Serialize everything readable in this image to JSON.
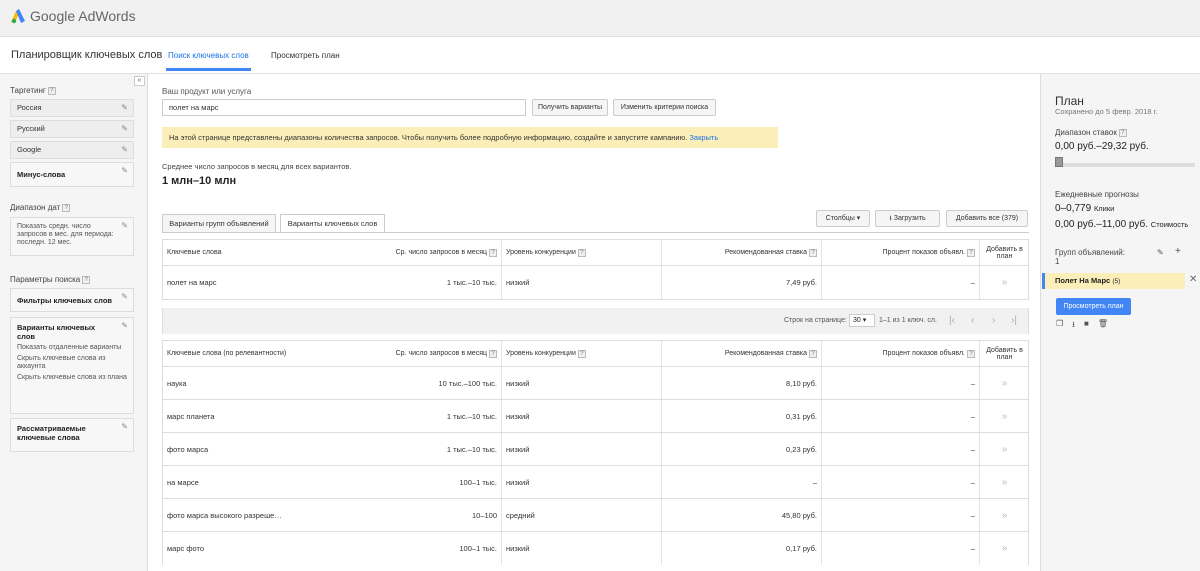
{
  "app": {
    "logo_text": "Google AdWords"
  },
  "header": {
    "page_title": "Планировщик ключевых слов",
    "tabs": [
      {
        "label": "Поиск ключевых слов",
        "active": true
      },
      {
        "label": "Просмотреть план",
        "active": false
      }
    ]
  },
  "left": {
    "collapse_label": "«",
    "targeting_label": "Таргетинг",
    "targeting_items": [
      "Россия",
      "Русский",
      "Google",
      "Минус-слова"
    ],
    "date_label": "Диапазон дат",
    "date_text": "Показать средн. число запросов в мес. для периода: последн. 12 мес.",
    "search_params_label": "Параметры поиска",
    "filters_label": "Фильтры ключевых слов",
    "variants_title": "Варианты ключевых слов",
    "variants_options": [
      "Показать отдаленные варианты",
      "Скрыть ключевые слова из аккаунта",
      "Скрыть ключевые слова из плана"
    ],
    "considered_label": "Рассматриваемые ключевые слова"
  },
  "main": {
    "product_label": "Ваш продукт или услуга",
    "product_value": "полет на марс",
    "get_variants_btn": "Получить варианты",
    "change_criteria_btn": "Изменить критерии поиска",
    "notice_text": "На этой странице представлены диапазоны количества запросов. Чтобы получить более подробную информацию, создайте и запустите кампанию.",
    "notice_link": "Закрыть",
    "avg_label": "Среднее число запросов в месяц для всех вариантов.",
    "avg_value": "1 млн–10 млн",
    "tab_groups": "Варианты групп объявлений",
    "tab_keywords": "Варианты ключевых слов",
    "columns_btn": "Столбцы",
    "download_btn": "Загрузить",
    "add_all_btn": "Добавить все (379)"
  },
  "table1": {
    "headers": [
      "Ключевые слова",
      "Ср. число запросов в месяц",
      "Уровень конкуренции",
      "Рекомендованная ставка",
      "Процент показов объявл.",
      "Добавить в план"
    ],
    "rows": [
      {
        "keyword": "полет на марс",
        "searches": "1 тыс.–10 тыс.",
        "competition": "низкий",
        "bid": "7,49 руб.",
        "share": "–",
        "add": "»"
      }
    ]
  },
  "pager": {
    "rows_label": "Строк на странице:",
    "rows_value": "30",
    "range_text": "1–1 из 1 ключ. сл."
  },
  "table2": {
    "headers": [
      "Ключевые слова (по релевантности)",
      "Ср. число запросов в месяц",
      "Уровень конкуренции",
      "Рекомендованная ставка",
      "Процент показов объявл.",
      "Добавить в план"
    ],
    "rows": [
      {
        "keyword": "наука",
        "searches": "10 тыс.–100 тыс.",
        "competition": "низкий",
        "bid": "8,10 руб.",
        "share": "–",
        "add": "»"
      },
      {
        "keyword": "марс планета",
        "searches": "1 тыс.–10 тыс.",
        "competition": "низкий",
        "bid": "0,31 руб.",
        "share": "–",
        "add": "»"
      },
      {
        "keyword": "фото марса",
        "searches": "1 тыс.–10 тыс.",
        "competition": "низкий",
        "bid": "0,23 руб.",
        "share": "–",
        "add": "»"
      },
      {
        "keyword": "на марсе",
        "searches": "100–1 тыс.",
        "competition": "низкий",
        "bid": "–",
        "share": "–",
        "add": "»"
      },
      {
        "keyword": "фото марса высокого разреше…",
        "searches": "10–100",
        "competition": "средний",
        "bid": "45,80 руб.",
        "share": "–",
        "add": "»"
      },
      {
        "keyword": "марс фото",
        "searches": "100–1 тыс.",
        "competition": "низкий",
        "bid": "0,17 руб.",
        "share": "–",
        "add": "»"
      }
    ]
  },
  "right": {
    "title": "План",
    "saved": "Сохранено до 5 февр. 2018 г.",
    "bid_range_label": "Диапазон ставок",
    "bid_range_value": "0,00 руб.–29,32 руб.",
    "daily_label": "Ежедневные прогнозы",
    "clicks_value": "0–0,779",
    "clicks_unit": "Клики",
    "cost_value": "0,00 руб.–11,00 руб.",
    "cost_unit": "Стоимость",
    "groups_label": "Групп объявлений:",
    "groups_count": "1",
    "plan_item": "Полет На Марс",
    "plan_item_count": "(5)",
    "view_plan_btn": "Просмотреть план"
  }
}
